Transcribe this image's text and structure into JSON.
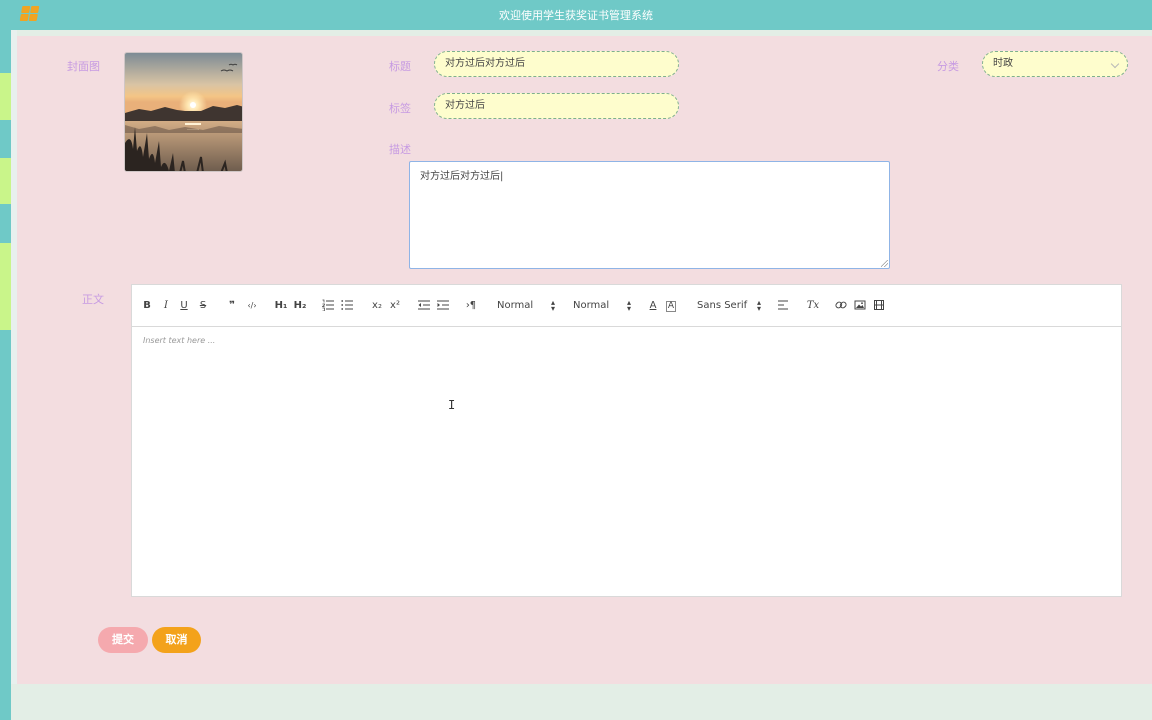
{
  "header": {
    "title": "欢迎使用学生获奖证书管理系统"
  },
  "form": {
    "cover_label": "封面图",
    "title_label": "标题",
    "title_value": "对方过后对方过后",
    "category_label": "分类",
    "category_value": "时政",
    "tags_label": "标签",
    "tags_value": "对方过后",
    "description_label": "描述",
    "description_value": "对方过后对方过后|",
    "content_label": "正文"
  },
  "editor": {
    "placeholder": "Insert text here ...",
    "toolbar": {
      "bold": "B",
      "italic": "I",
      "underline": "U",
      "strike": "S",
      "blockquote": "❞",
      "code": "‹/›",
      "h1": "H₁",
      "h2": "H₂",
      "sub": "x₂",
      "sup": "x²",
      "rtl": "›¶",
      "header_select": "Normal",
      "size_select": "Normal",
      "font_select": "Sans Serif",
      "clean": "Tx",
      "color": "A",
      "background": "A"
    }
  },
  "buttons": {
    "submit": "提交",
    "cancel": "取消"
  },
  "colors": {
    "topbar": "#6fc9c7",
    "panel": "#f3dde0",
    "label": "#c79be2",
    "field_bg": "#fefdcd",
    "submit": "#f5a9ae",
    "cancel": "#f3a21b",
    "logo": "#f0a423"
  }
}
